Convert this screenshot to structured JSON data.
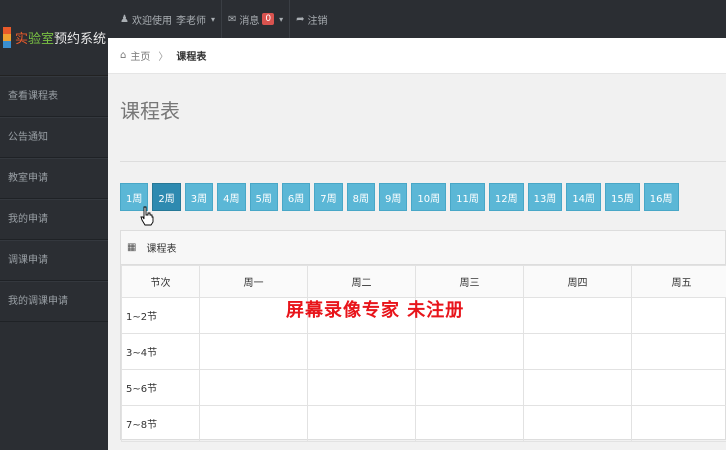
{
  "brand": {
    "title_part1": "实",
    "title_part2": "验室",
    "title_part3": "预约系统"
  },
  "sidebar": {
    "items": [
      {
        "label": "查看课程表"
      },
      {
        "label": "公告通知"
      },
      {
        "label": "教室申请"
      },
      {
        "label": "我的申请"
      },
      {
        "label": "调课申请"
      },
      {
        "label": "我的调课申请"
      }
    ]
  },
  "topbar": {
    "welcome": "欢迎使用",
    "user": "李老师",
    "messages_label": "消息",
    "messages_count": "0",
    "logout": "注销"
  },
  "breadcrumb": {
    "home": "主页",
    "separator": "〉",
    "current": "课程表"
  },
  "page": {
    "title": "课程表"
  },
  "weeks": [
    "1周",
    "2周",
    "3周",
    "4周",
    "5周",
    "6周",
    "7周",
    "8周",
    "9周",
    "10周",
    "11周",
    "12周",
    "13周",
    "14周",
    "15周",
    "16周"
  ],
  "active_week": "2周",
  "panel": {
    "title": "课程表"
  },
  "table": {
    "headers": [
      "节次",
      "周一",
      "周二",
      "周三",
      "周四",
      "周五"
    ],
    "rows": [
      "1~2节",
      "3~4节",
      "5~6节",
      "7~8节"
    ]
  },
  "watermark": "屏幕录像专家  未注册",
  "colors": {
    "sidebar_bg": "#2b2e33",
    "week_button": "#5bb7d6",
    "week_button_active": "#2e8ab0",
    "watermark": "#e8151b",
    "badge": "#d9534f"
  }
}
